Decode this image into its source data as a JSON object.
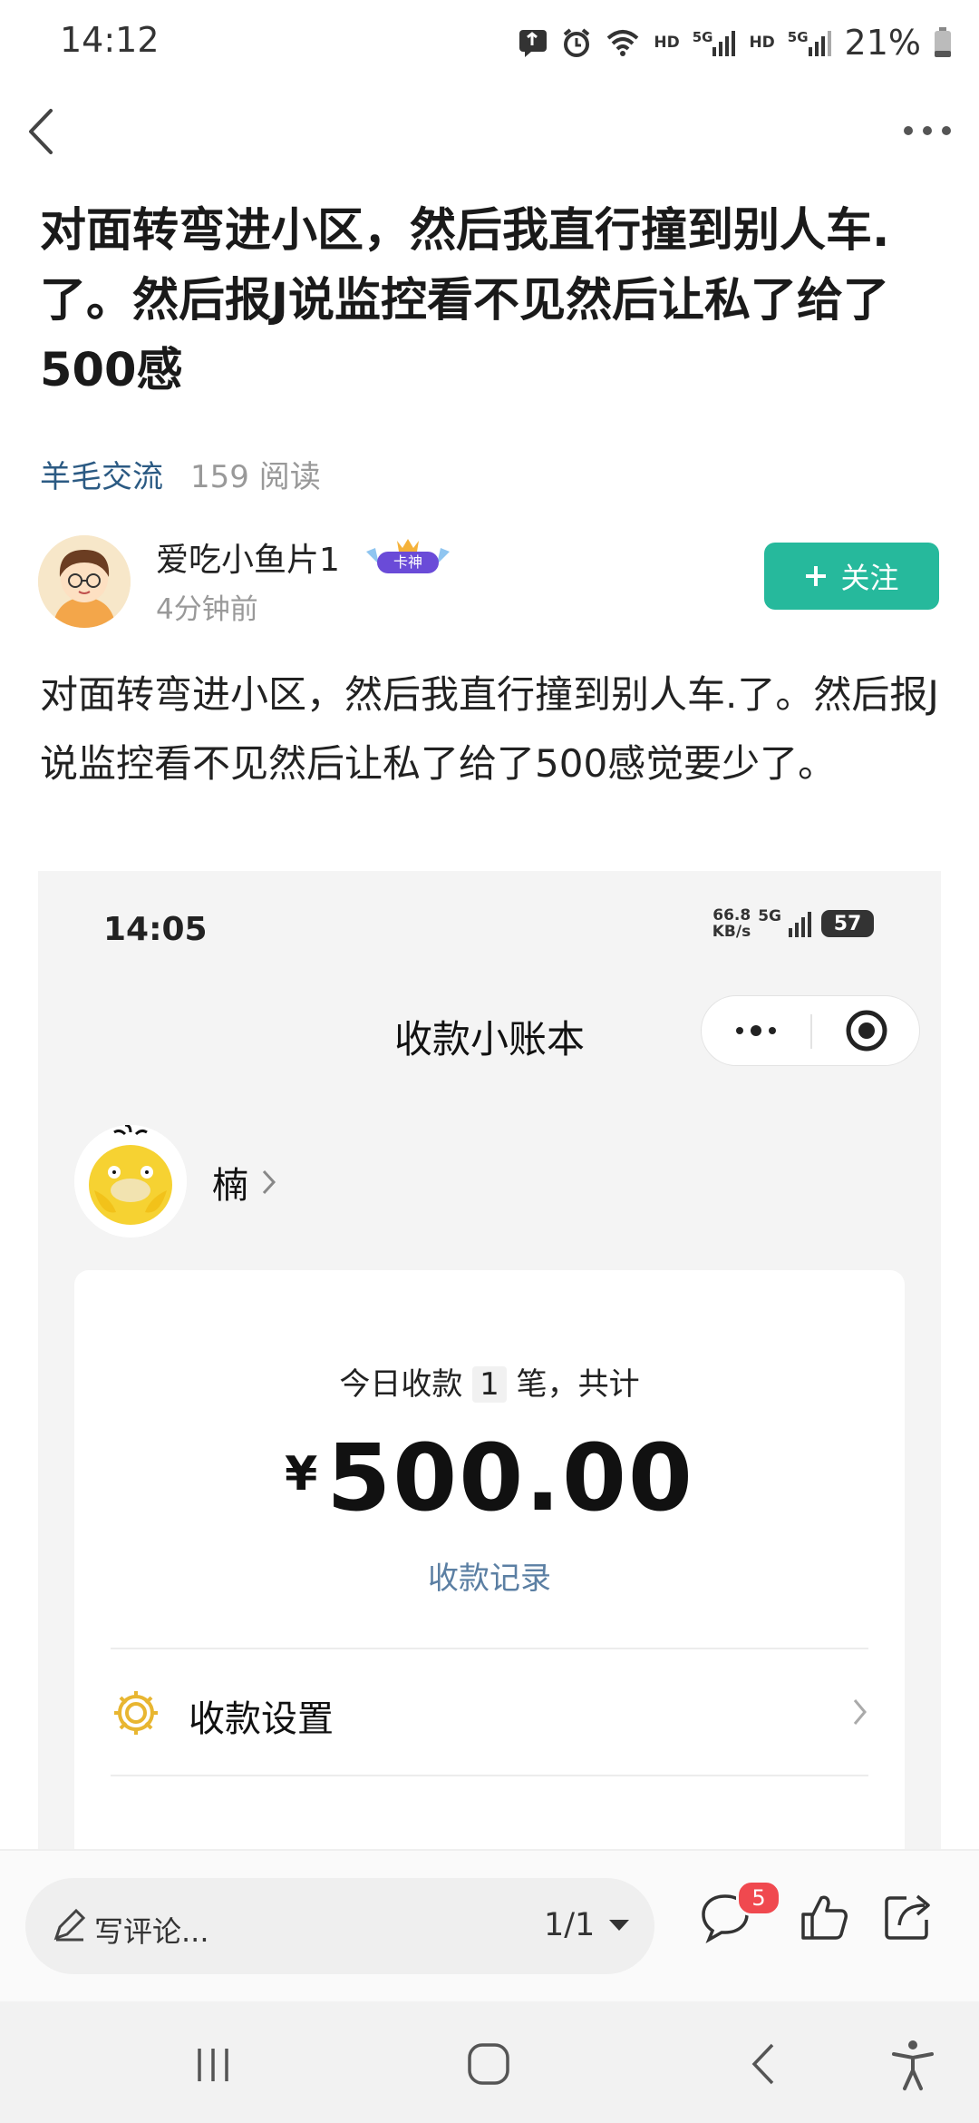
{
  "status_bar": {
    "time": "14:12",
    "hd1": "HD",
    "net1": "5G",
    "hd2": "HD",
    "net2": "5G",
    "battery": "21%"
  },
  "post": {
    "title": "对面转弯进小区，然后我直行撞到别人车.了。然后报J说监控看不见然后让私了给了500感",
    "category": "羊毛交流",
    "read_count": "159 阅读",
    "author": {
      "name": "爱吃小鱼片1",
      "badge": "卡神",
      "time": "4分钟前"
    },
    "follow_label": "关注",
    "body": "对面转弯进小区，然后我直行撞到别人车.了。然后报J说监控看不见然后让私了给了500感觉要少了。"
  },
  "embedded": {
    "time": "14:05",
    "speed_value": "66.8",
    "speed_unit": "KB/s",
    "net": "5G",
    "battery": "57",
    "title": "收款小账本",
    "username": "楠",
    "today_prefix": "今日收款",
    "today_count": "1",
    "today_suffix": "笔，共计",
    "currency": "¥",
    "amount": "500.00",
    "records_link": "收款记录",
    "setting_label": "收款设置"
  },
  "bottom_bar": {
    "comment_placeholder": "写评论...",
    "page_indicator": "1/1",
    "comment_badge": "5"
  },
  "colors": {
    "accent_green": "#26b99c",
    "category_blue": "#2b5a83",
    "badge_red": "#f0494f",
    "link_blue": "#5b7fa3"
  }
}
